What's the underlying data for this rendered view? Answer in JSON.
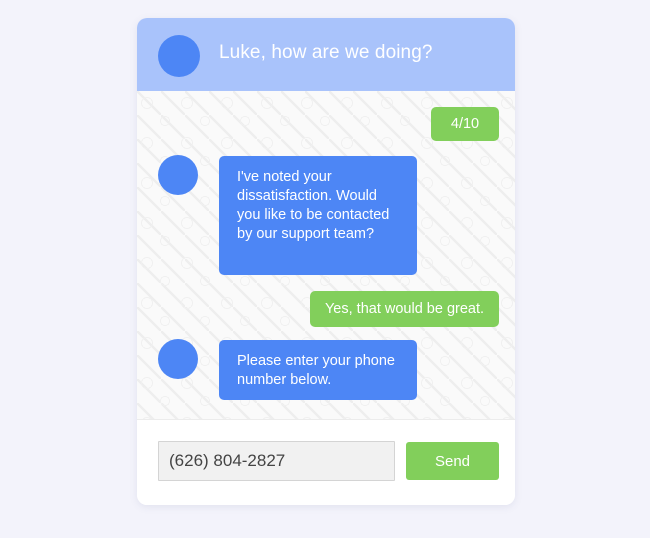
{
  "header": {
    "title": "Luke, how are we doing?"
  },
  "messages": [
    {
      "sender": "user",
      "text": "4/10"
    },
    {
      "sender": "bot",
      "text": "I've noted your dissatisfaction. Would you like to be contacted by our support team?"
    },
    {
      "sender": "user",
      "text": "Yes, that would be great."
    },
    {
      "sender": "bot",
      "text": "Please enter your phone number below."
    }
  ],
  "composer": {
    "value": "(626) 804-2827",
    "send_label": "Send"
  },
  "colors": {
    "header": "#a9c3fb",
    "bot_bubble": "#4d86f5",
    "user_bubble": "#82cf5b",
    "page_background": "#f3f3fb"
  }
}
